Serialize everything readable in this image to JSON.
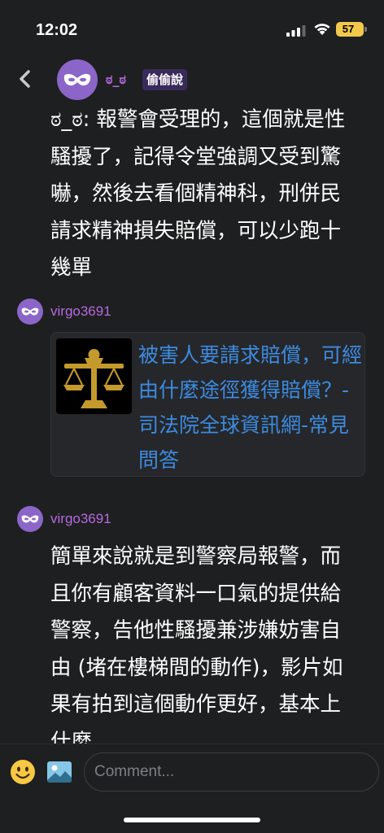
{
  "status_bar": {
    "time": "12:02",
    "battery": "57"
  },
  "header": {
    "display_name": "ಠ_ಠ",
    "badge": "偷偷說"
  },
  "message": {
    "text": "ಠ_ಠ: 報警會受理的，這個就是性騷擾了，記得令堂強調又受到驚嚇，然後去看個精神科，刑併民請求精神損失賠償，可以少跑十幾單"
  },
  "comments": [
    {
      "username": "virgo3691",
      "link_card": {
        "title": "被害人要請求賠償，可經由什麼途徑獲得賠償？-司法院全球資訊網-常見問答"
      }
    },
    {
      "username": "virgo3691",
      "text": "簡單來說就是到警察局報警，而且你有顧客資料一口氣的提供給警察，告他性騷擾兼涉嫌妨害自由 (堵在樓梯間的動作)，影片如果有拍到這個動作更好，基本上什麼"
    }
  ],
  "composer": {
    "placeholder": "Comment..."
  },
  "icons": {
    "back": "chevron-left-icon",
    "avatar": "mask-icon",
    "thumbnail": "scales-of-justice-icon",
    "emoji": "smiley-icon",
    "image": "image-icon"
  },
  "colors": {
    "background": "#1e1f20",
    "username": "#b56ae0",
    "link": "#3d8be0",
    "avatar": "#8c65c9",
    "badge_bg": "#3a2a5c",
    "battery": "#f2c94c"
  }
}
